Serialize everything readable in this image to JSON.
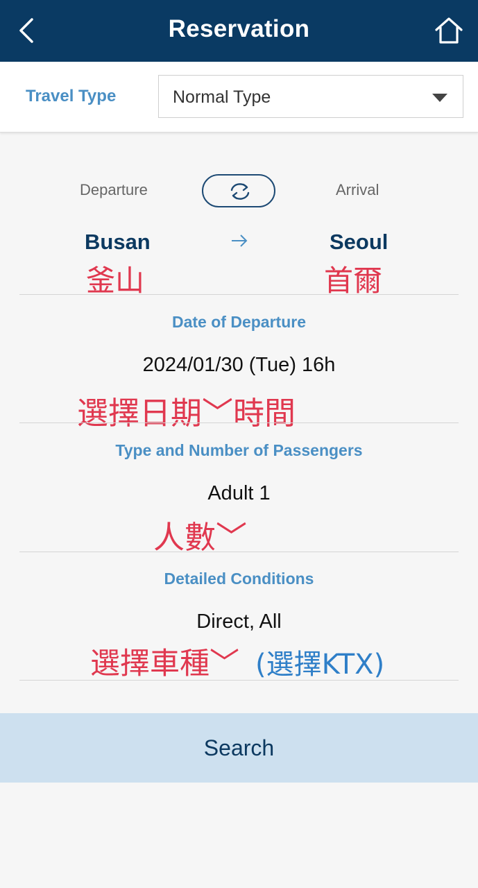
{
  "header": {
    "title": "Reservation",
    "back_icon": "chevron-left-icon",
    "home_icon": "home-icon"
  },
  "travel_type": {
    "label": "Travel Type",
    "selected": "Normal Type"
  },
  "route": {
    "departure_label": "Departure",
    "arrival_label": "Arrival",
    "swap_icon": "swap-icon",
    "departure_city": "Busan",
    "arrival_city": "Seoul",
    "departure_note": "釜山",
    "arrival_note": "首爾",
    "arrow": "→"
  },
  "date_section": {
    "title": "Date of Departure",
    "value": "2024/01/30 (Tue) 16h",
    "note": "選擇日期﹀時間"
  },
  "passenger_section": {
    "title": "Type and Number of Passengers",
    "value": "Adult 1",
    "note": "人數﹀"
  },
  "conditions_section": {
    "title": "Detailed Conditions",
    "value": "Direct, All",
    "note": "選擇車種﹀",
    "note_blue": "(選擇KTX)"
  },
  "search_label": "Search",
  "colors": {
    "header_bg": "#0a3a63",
    "accent_blue": "#4a8fc4",
    "annotation_red": "#e0384f",
    "annotation_blue": "#2f7fc8",
    "search_bg": "#cde0ef"
  }
}
